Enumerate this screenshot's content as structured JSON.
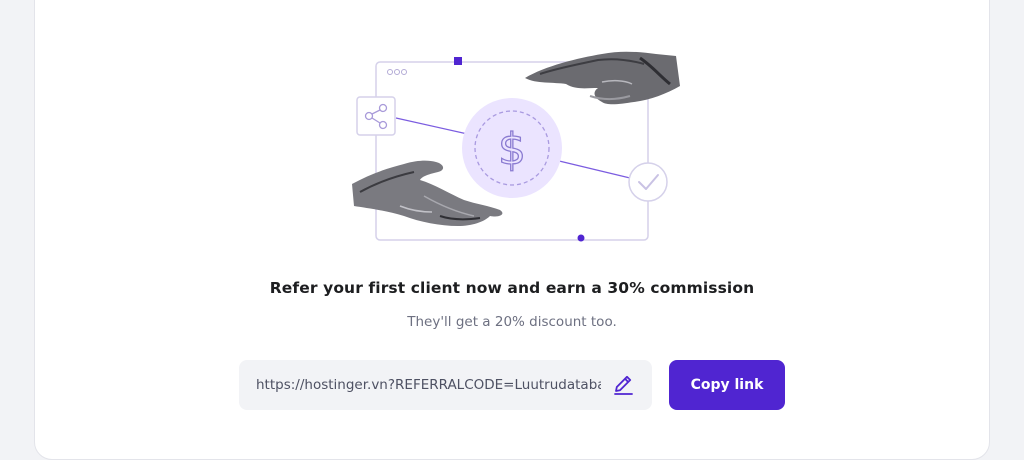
{
  "card": {
    "headline": "Refer your first client now and earn a 30% commission",
    "subline": "They'll get a 20% discount too."
  },
  "referral": {
    "link_value": "https://hostinger.vn?REFERRALCODE=Luutrudataba",
    "copy_label": "Copy link"
  },
  "illustration": {
    "currency_symbol": "$",
    "icons": [
      "share-icon",
      "checkmark-icon",
      "dollar-icon",
      "edit-pencil-icon"
    ]
  },
  "colors": {
    "brand": "#5025d1",
    "lavender": "#ebe4ff",
    "outline": "#d5d1ea",
    "text_dark": "#1d1e20",
    "text_muted": "#6d7081"
  }
}
